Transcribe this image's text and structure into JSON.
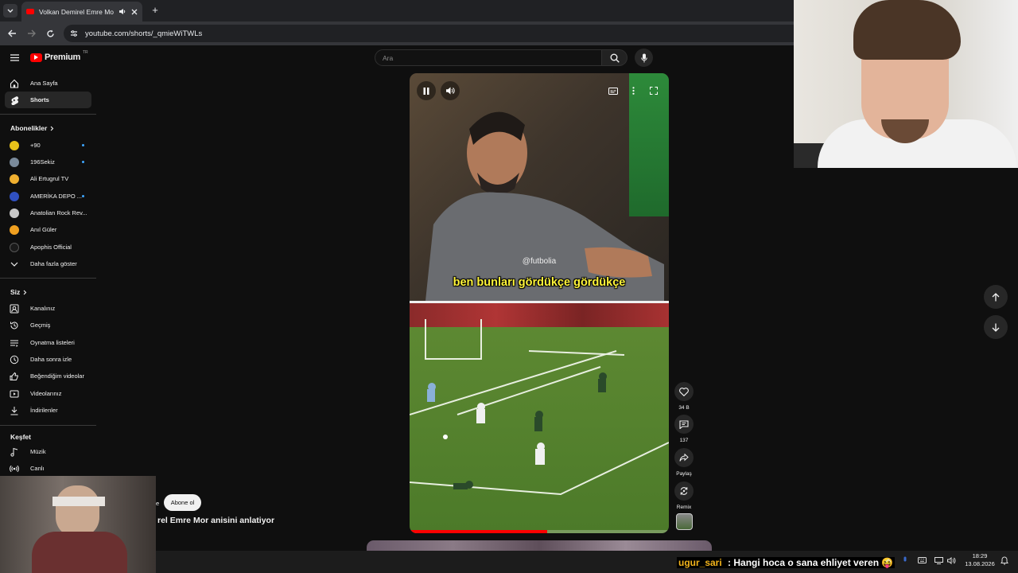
{
  "browser": {
    "tab_title": "Volkan Demirel Emre Mor a",
    "url": "youtube.com/shorts/_qmieWiTWLs"
  },
  "header": {
    "brand": "Premium",
    "brand_suffix": "TR",
    "search_placeholder": "Ara"
  },
  "sidebar": {
    "main": [
      {
        "label": "Ana Sayfa",
        "icon": "home-icon"
      },
      {
        "label": "Shorts",
        "icon": "shorts-icon",
        "active": true
      }
    ],
    "subscriptions_heading": "Abonelikler",
    "subscriptions": [
      {
        "label": "+90",
        "color": "#e8c21a",
        "new": true
      },
      {
        "label": "196Sekiz",
        "color": "#7a8a9a",
        "new": true
      },
      {
        "label": "Ali Ertugrul TV",
        "color": "#f0b030",
        "new": false
      },
      {
        "label": "AMERİKA DEPO ...",
        "color": "#3050c0",
        "new": true
      },
      {
        "label": "Anatolian Rock Rev...",
        "color": "#c8c8c8",
        "new": false
      },
      {
        "label": "Anıl Güler",
        "color": "#f0a020",
        "new": false
      },
      {
        "label": "Apophis Official",
        "color": "#1a1a1a",
        "new": false
      }
    ],
    "show_more": "Daha fazla göster",
    "you_heading": "Siz",
    "you": [
      {
        "label": "Kanalınız",
        "icon": "channel-icon"
      },
      {
        "label": "Geçmiş",
        "icon": "history-icon"
      },
      {
        "label": "Oynatma listeleri",
        "icon": "playlist-icon"
      },
      {
        "label": "Daha sonra izle",
        "icon": "clock-icon"
      },
      {
        "label": "Beğendiğim videolar",
        "icon": "like-icon"
      },
      {
        "label": "Videolarınız",
        "icon": "video-icon"
      },
      {
        "label": "İndirilenler",
        "icon": "download-icon"
      }
    ],
    "explore_heading": "Keşfet",
    "explore": [
      {
        "label": "Müzik",
        "icon": "music-icon"
      },
      {
        "label": "Canlı",
        "icon": "live-icon"
      }
    ]
  },
  "short": {
    "watermark": "@futbolia",
    "caption": "ben bunları gördükçe gördükçe",
    "progress": 0.53,
    "title": "rel Emre Mor anisini anlatiyor",
    "title_fragment": "e",
    "subscribe_label": "Abone ol"
  },
  "actions": {
    "likes": "34 B",
    "comments": "137",
    "share": "Paylaş",
    "remix": "Remix"
  },
  "stream_chat": {
    "user": "ugur_sari",
    "message": " : Hangi hoca o sana ehliyet veren 😝"
  },
  "taskbar": {
    "time": "18:29",
    "date": "13.08.2026"
  }
}
